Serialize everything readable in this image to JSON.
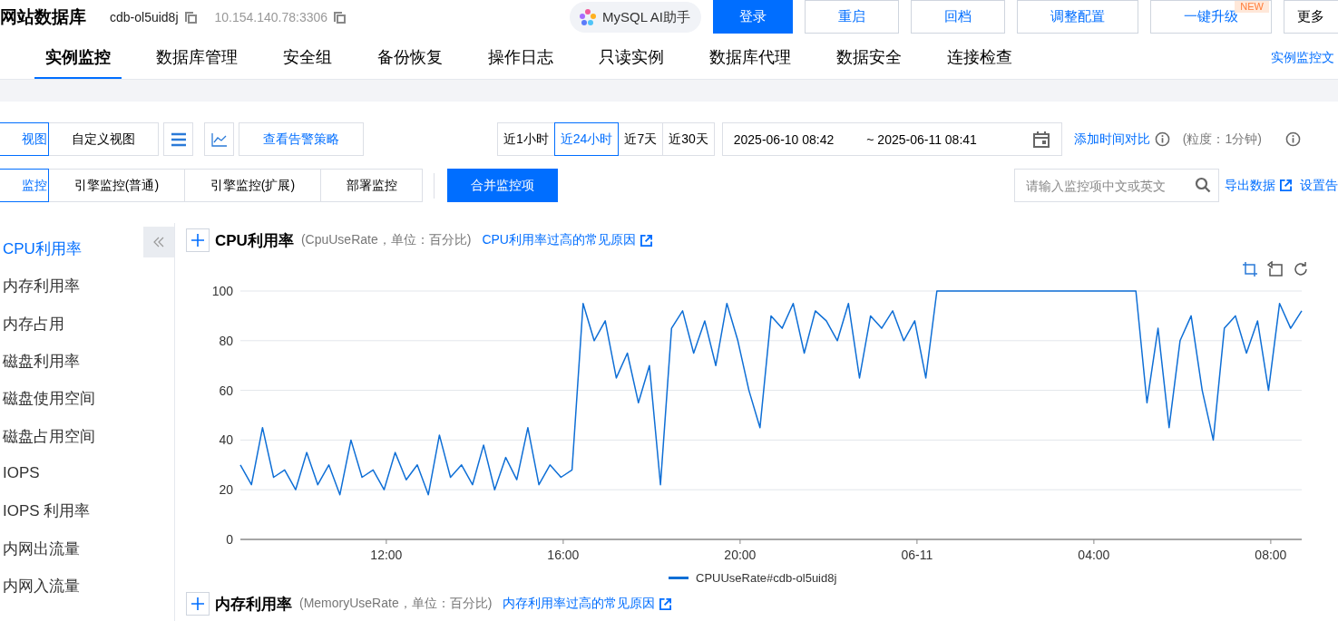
{
  "header": {
    "title": "网站数据库",
    "instance_id": "cdb-ol5uid8j",
    "address": "10.154.140.78:3306",
    "ai_assistant": "MySQL AI助手",
    "buttons": [
      {
        "label": "登录",
        "kind": "primary"
      },
      {
        "label": "重启",
        "kind": "default"
      },
      {
        "label": "回档",
        "kind": "default"
      },
      {
        "label": "调整配置",
        "kind": "default"
      },
      {
        "label": "一键升级",
        "kind": "default",
        "badge": "NEW"
      },
      {
        "label": "更多",
        "kind": "plain"
      }
    ]
  },
  "tabs": [
    {
      "label": "实例监控",
      "selected": true
    },
    {
      "label": "数据库管理",
      "selected": false
    },
    {
      "label": "安全组",
      "selected": false
    },
    {
      "label": "备份恢复",
      "selected": false
    },
    {
      "label": "操作日志",
      "selected": false
    },
    {
      "label": "只读实例",
      "selected": false
    },
    {
      "label": "数据库代理",
      "selected": false
    },
    {
      "label": "数据安全",
      "selected": false
    },
    {
      "label": "连接检查",
      "selected": false
    }
  ],
  "doc_link": "实例监控文",
  "view_switch": [
    {
      "label": "视图",
      "selected": true
    },
    {
      "label": "自定义视图",
      "selected": false
    }
  ],
  "alarm_policy_button": "查看告警策略",
  "time_ranges": [
    {
      "label": "近1小时",
      "selected": false
    },
    {
      "label": "近24小时",
      "selected": true
    },
    {
      "label": "近7天",
      "selected": false
    },
    {
      "label": "近30天",
      "selected": false
    }
  ],
  "date_range": {
    "start": "2025-06-10 08:42",
    "end": "~ 2025-06-11 08:41"
  },
  "compare_link": "添加时间对比",
  "granularity": "(粒度：1分钟)",
  "monitor_tabs": [
    {
      "label": "监控",
      "selected": true
    },
    {
      "label": "引擎监控(普通)",
      "selected": false
    },
    {
      "label": "引擎监控(扩展)",
      "selected": false
    },
    {
      "label": "部署监控",
      "selected": false
    }
  ],
  "merge_button": "合并监控项",
  "search": {
    "placeholder": "请输入监控项中文或英文"
  },
  "export_link": "导出数据",
  "alarm_link": "设置告",
  "metrics": [
    {
      "label": "CPU利用率",
      "selected": true
    },
    {
      "label": "内存利用率",
      "selected": false
    },
    {
      "label": "内存占用",
      "selected": false
    },
    {
      "label": "磁盘利用率",
      "selected": false
    },
    {
      "label": "磁盘使用空间",
      "selected": false
    },
    {
      "label": "磁盘占用空间",
      "selected": false
    },
    {
      "label": "IOPS",
      "selected": false
    },
    {
      "label": "IOPS 利用率",
      "selected": false
    },
    {
      "label": "内网出流量",
      "selected": false
    },
    {
      "label": "内网入流量",
      "selected": false
    }
  ],
  "panels": [
    {
      "title": "CPU利用率",
      "subtitle": "(CpuUseRate，单位：百分比)",
      "link": "CPU利用率过高的常见原因",
      "chart_data": {
        "type": "line",
        "grid": true,
        "x": [
          "2025-06-10T08:42",
          "2025-06-10T08:57",
          "2025-06-10T09:12",
          "2025-06-10T09:27",
          "2025-06-10T09:42",
          "2025-06-10T09:57",
          "2025-06-10T10:12",
          "2025-06-10T10:27",
          "2025-06-10T10:42",
          "2025-06-10T10:57",
          "2025-06-10T11:12",
          "2025-06-10T11:27",
          "2025-06-10T11:42",
          "2025-06-10T11:57",
          "2025-06-10T12:12",
          "2025-06-10T12:27",
          "2025-06-10T12:42",
          "2025-06-10T12:57",
          "2025-06-10T13:12",
          "2025-06-10T13:27",
          "2025-06-10T13:42",
          "2025-06-10T13:57",
          "2025-06-10T14:12",
          "2025-06-10T14:27",
          "2025-06-10T14:42",
          "2025-06-10T14:57",
          "2025-06-10T15:12",
          "2025-06-10T15:27",
          "2025-06-10T15:42",
          "2025-06-10T15:57",
          "2025-06-10T16:12",
          "2025-06-10T16:27",
          "2025-06-10T16:42",
          "2025-06-10T16:57",
          "2025-06-10T17:12",
          "2025-06-10T17:27",
          "2025-06-10T17:42",
          "2025-06-10T17:57",
          "2025-06-10T18:12",
          "2025-06-10T18:27",
          "2025-06-10T18:42",
          "2025-06-10T18:57",
          "2025-06-10T19:12",
          "2025-06-10T19:27",
          "2025-06-10T19:42",
          "2025-06-10T19:57",
          "2025-06-10T20:12",
          "2025-06-10T20:27",
          "2025-06-10T20:42",
          "2025-06-10T20:57",
          "2025-06-10T21:12",
          "2025-06-10T21:27",
          "2025-06-10T21:42",
          "2025-06-10T21:57",
          "2025-06-10T22:12",
          "2025-06-10T22:27",
          "2025-06-10T22:42",
          "2025-06-10T22:57",
          "2025-06-10T23:12",
          "2025-06-10T23:27",
          "2025-06-10T23:42",
          "2025-06-10T23:57",
          "2025-06-11T00:12",
          "2025-06-11T00:27",
          "2025-06-11T00:42",
          "2025-06-11T00:57",
          "2025-06-11T01:12",
          "2025-06-11T01:27",
          "2025-06-11T01:42",
          "2025-06-11T01:57",
          "2025-06-11T02:12",
          "2025-06-11T02:27",
          "2025-06-11T02:42",
          "2025-06-11T02:57",
          "2025-06-11T03:12",
          "2025-06-11T03:27",
          "2025-06-11T03:42",
          "2025-06-11T03:57",
          "2025-06-11T04:12",
          "2025-06-11T04:27",
          "2025-06-11T04:42",
          "2025-06-11T04:57",
          "2025-06-11T05:12",
          "2025-06-11T05:27",
          "2025-06-11T05:42",
          "2025-06-11T05:57",
          "2025-06-11T06:12",
          "2025-06-11T06:27",
          "2025-06-11T06:42",
          "2025-06-11T06:57",
          "2025-06-11T07:12",
          "2025-06-11T07:27",
          "2025-06-11T07:42",
          "2025-06-11T07:57",
          "2025-06-11T08:12",
          "2025-06-11T08:27",
          "2025-06-11T08:42"
        ],
        "series": [
          {
            "name": "CPUUseRate#cdb-ol5uid8j",
            "color": "#0f6fd6",
            "values": [
              30,
              22,
              45,
              25,
              28,
              20,
              35,
              22,
              30,
              18,
              40,
              25,
              28,
              20,
              35,
              24,
              30,
              18,
              42,
              25,
              30,
              22,
              38,
              20,
              33,
              24,
              45,
              22,
              30,
              25,
              28,
              95,
              80,
              88,
              65,
              75,
              55,
              70,
              22,
              85,
              92,
              75,
              88,
              70,
              95,
              80,
              60,
              45,
              90,
              85,
              95,
              75,
              92,
              88,
              80,
              95,
              65,
              90,
              85,
              92,
              80,
              88,
              65,
              100,
              100,
              100,
              100,
              100,
              100,
              100,
              100,
              100,
              100,
              100,
              100,
              100,
              100,
              100,
              100,
              100,
              100,
              100,
              55,
              85,
              45,
              80,
              90,
              60,
              40,
              85,
              90,
              75,
              88,
              60,
              95,
              85,
              92
            ]
          }
        ],
        "xlim": [
          "2025-06-10T08:42",
          "2025-06-11T08:42"
        ],
        "ylim": [
          0,
          100
        ],
        "xticks": [
          {
            "value": "2025-06-10T12:00",
            "label": "12:00"
          },
          {
            "value": "2025-06-10T16:00",
            "label": "16:00"
          },
          {
            "value": "2025-06-10T20:00",
            "label": "20:00"
          },
          {
            "value": "2025-06-11T00:00",
            "label": "06-11"
          },
          {
            "value": "2025-06-11T04:00",
            "label": "04:00"
          },
          {
            "value": "2025-06-11T08:00",
            "label": "08:00"
          }
        ],
        "yticks": [
          0,
          20,
          40,
          60,
          80,
          100
        ]
      }
    },
    {
      "title": "内存利用率",
      "subtitle": "(MemoryUseRate，单位：百分比)",
      "link": "内存利用率过高的常见原因"
    }
  ]
}
